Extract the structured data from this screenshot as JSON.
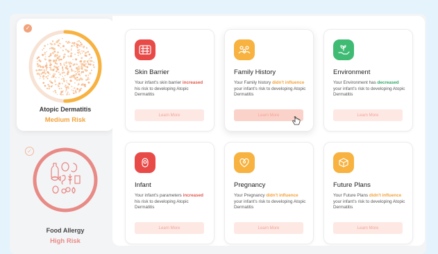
{
  "sidebar": {
    "conditions": [
      {
        "title": "Atopic Dermatitis",
        "risk": "Medium Risk",
        "risk_color": "#f2a13a",
        "selected": true,
        "progress": 0.5
      },
      {
        "title": "Food Allergy",
        "risk": "High Risk",
        "risk_color": "#e88a85",
        "selected": false,
        "progress": 1.0
      }
    ]
  },
  "cards": [
    {
      "title": "Skin Barrier",
      "icon": "skin-barrier-icon",
      "icon_bg": "#e84a48",
      "desc": [
        {
          "t": "Your infant's skin barrier "
        },
        {
          "t": "increased",
          "c": "red"
        },
        {
          "t": " his risk to developing Atopic Dermatitis"
        }
      ],
      "button": "Learn More"
    },
    {
      "title": "Family History",
      "icon": "family-icon",
      "icon_bg": "#f7b240",
      "desc": [
        {
          "t": "Your Family history "
        },
        {
          "t": "didn't influence",
          "c": "org"
        },
        {
          "t": " your infant's risk to developing Atopic Dermatitis"
        }
      ],
      "button": "Learn More"
    },
    {
      "title": "Environment",
      "icon": "plant-hand-icon",
      "icon_bg": "#3fbb74",
      "desc": [
        {
          "t": "Your Environment has "
        },
        {
          "t": "decreased",
          "c": "grn"
        },
        {
          "t": " your infant's risk to developing Atopic Dermatitis"
        }
      ],
      "button": "Learn More"
    },
    {
      "title": "Infant",
      "icon": "baby-icon",
      "icon_bg": "#e84a48",
      "desc": [
        {
          "t": "Your infant's parameters "
        },
        {
          "t": "increased",
          "c": "red"
        },
        {
          "t": " his risk to developing Atopic Dermatitis"
        }
      ],
      "button": "Learn More"
    },
    {
      "title": "Pregnancy",
      "icon": "pregnancy-icon",
      "icon_bg": "#f7b240",
      "desc": [
        {
          "t": "Your Pregnancy "
        },
        {
          "t": "didn't influence",
          "c": "org"
        },
        {
          "t": " your infant's risk to developing Atopic Dermatitis"
        }
      ],
      "button": "Learn More"
    },
    {
      "title": "Future Plans",
      "icon": "box-icon",
      "icon_bg": "#f7b240",
      "desc": [
        {
          "t": "Your Future Plans "
        },
        {
          "t": "didn't influence",
          "c": "org"
        },
        {
          "t": " your infant's risk to developing Atopic Dermatitis"
        }
      ],
      "button": "Learn More"
    }
  ]
}
